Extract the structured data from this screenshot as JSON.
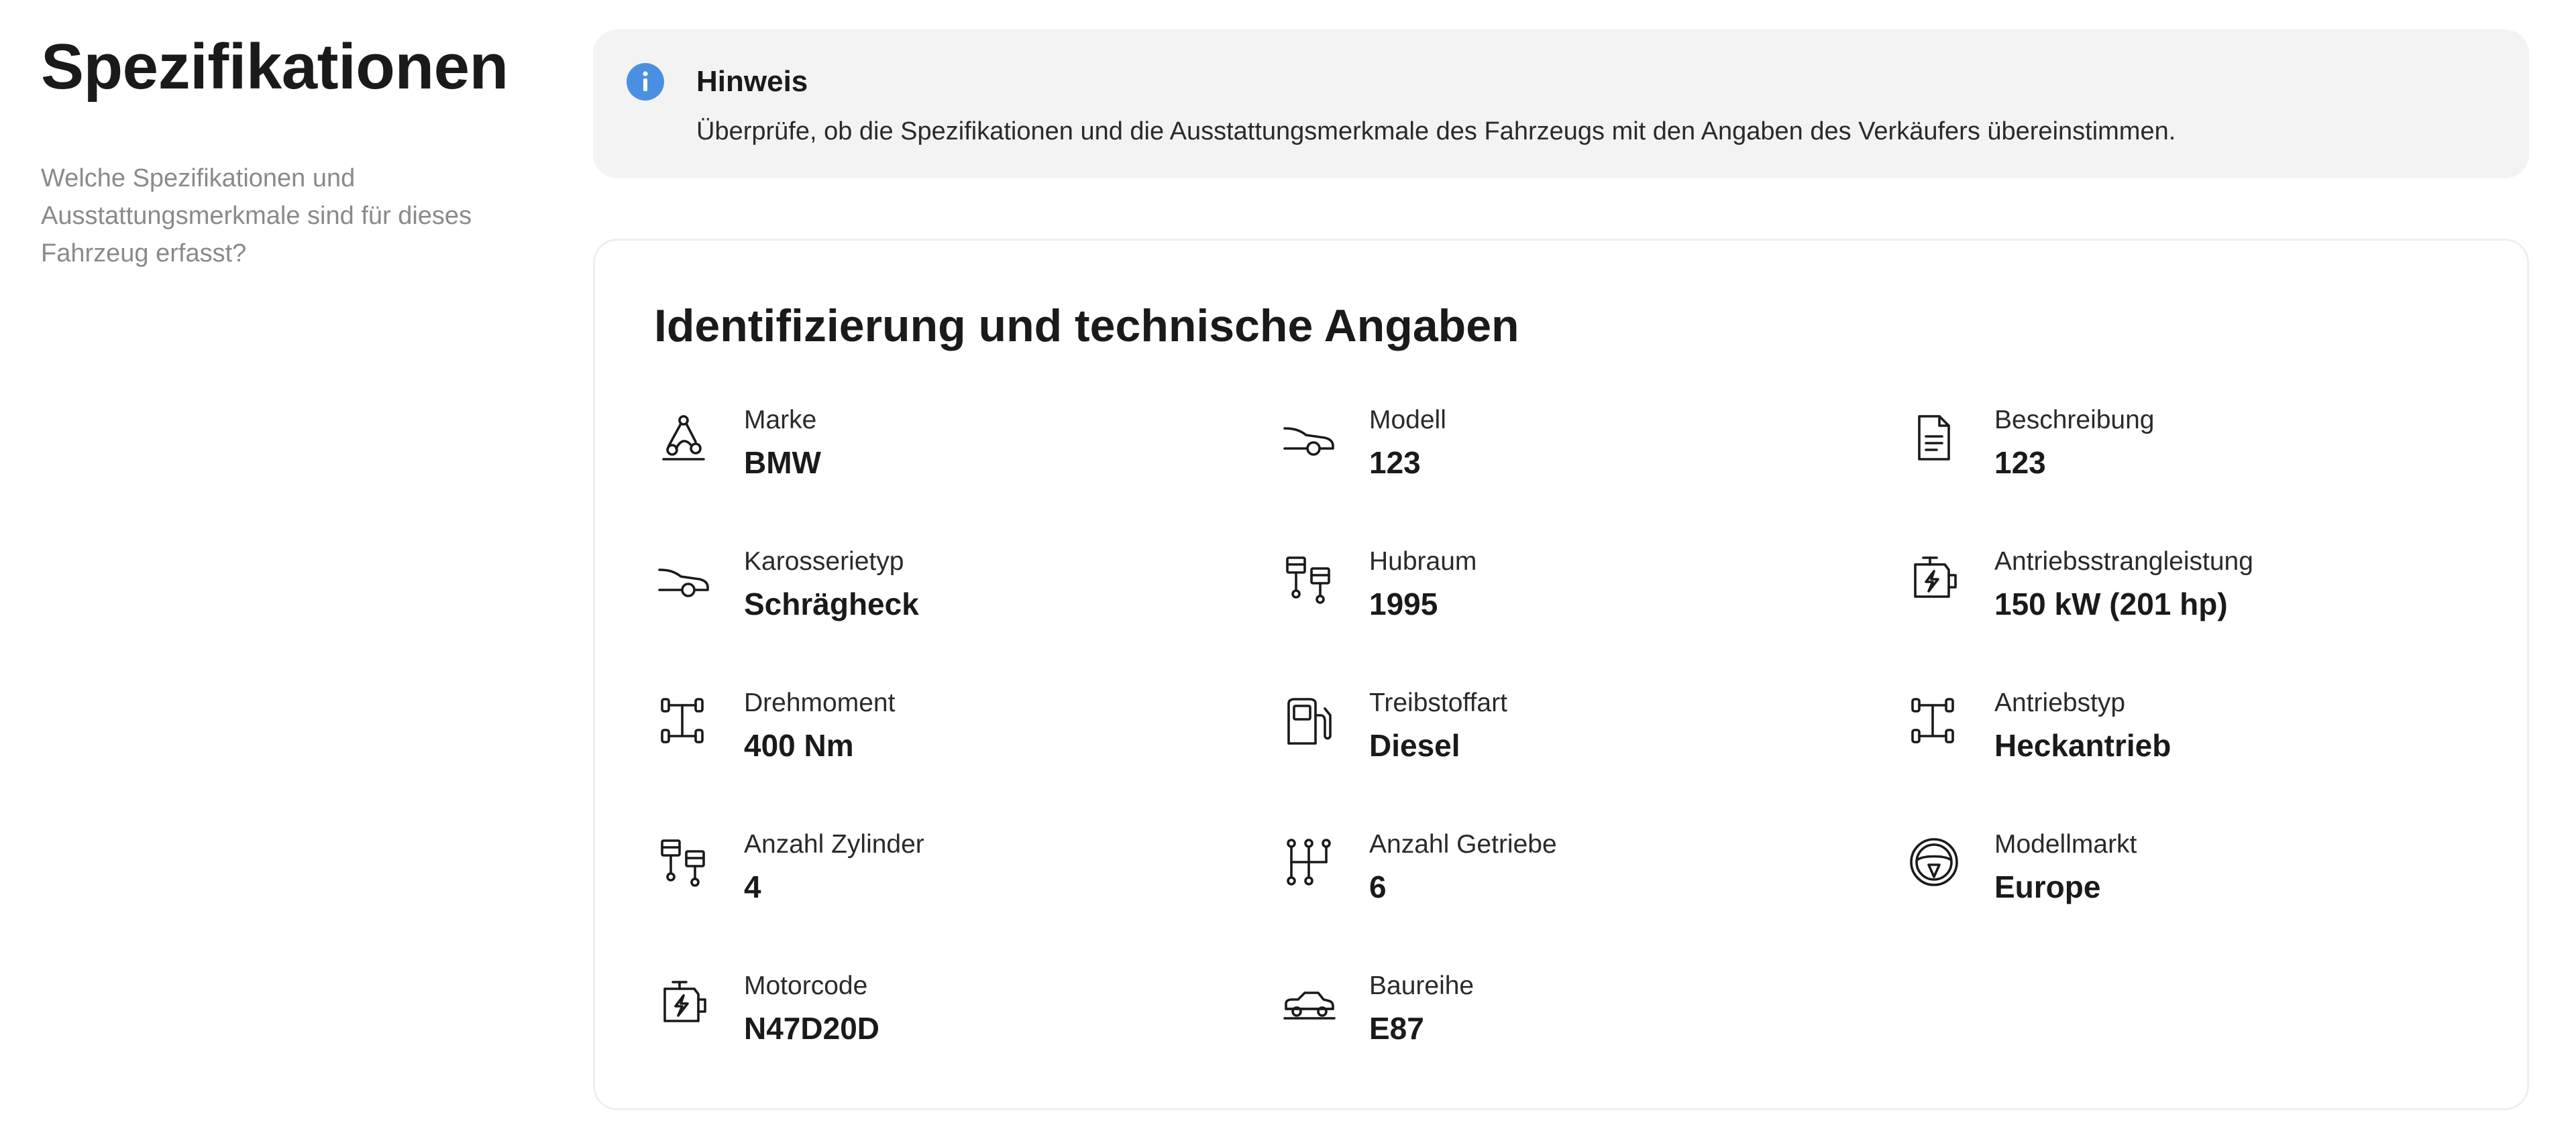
{
  "section": {
    "title": "Spezifikationen",
    "subtitle": "Welche Spezifikationen und Ausstattungsmerkmale sind für dieses Fahrzeug erfasst?"
  },
  "notice": {
    "icon": "info-icon",
    "accent_color": "#4a90e2",
    "title": "Hinweis",
    "text": "Überprüfe, ob die Spezifikationen und die Ausstattungsmerkmale des Fahrzeugs mit den Angaben des Verkäufers übereinstimmen."
  },
  "card": {
    "title": "Identifizierung und technische Angaben",
    "specs": [
      {
        "icon": "brand-icon",
        "label": "Marke",
        "value": "BMW"
      },
      {
        "icon": "car-side-icon",
        "label": "Modell",
        "value": "123"
      },
      {
        "icon": "document-icon",
        "label": "Beschreibung",
        "value": "123"
      },
      {
        "icon": "car-body-icon",
        "label": "Karosserietyp",
        "value": "Schrägheck"
      },
      {
        "icon": "pistons-icon",
        "label": "Hubraum",
        "value": "1995"
      },
      {
        "icon": "engine-power-icon",
        "label": "Antriebsstrangleistung",
        "value": "150 kW (201 hp)"
      },
      {
        "icon": "drivetrain-icon",
        "label": "Drehmoment",
        "value": "400 Nm"
      },
      {
        "icon": "fuel-pump-icon",
        "label": "Treibstoffart",
        "value": "Diesel"
      },
      {
        "icon": "drivetrain-icon",
        "label": "Antriebstyp",
        "value": "Heckantrieb"
      },
      {
        "icon": "pistons-icon",
        "label": "Anzahl Zylinder",
        "value": "4"
      },
      {
        "icon": "gear-shift-icon",
        "label": "Anzahl Getriebe",
        "value": "6"
      },
      {
        "icon": "steering-wheel-icon",
        "label": "Modellmarkt",
        "value": "Europe"
      },
      {
        "icon": "engine-power-icon",
        "label": "Motorcode",
        "value": "N47D20D"
      },
      {
        "icon": "sedan-icon",
        "label": "Baureihe",
        "value": "E87"
      }
    ]
  }
}
